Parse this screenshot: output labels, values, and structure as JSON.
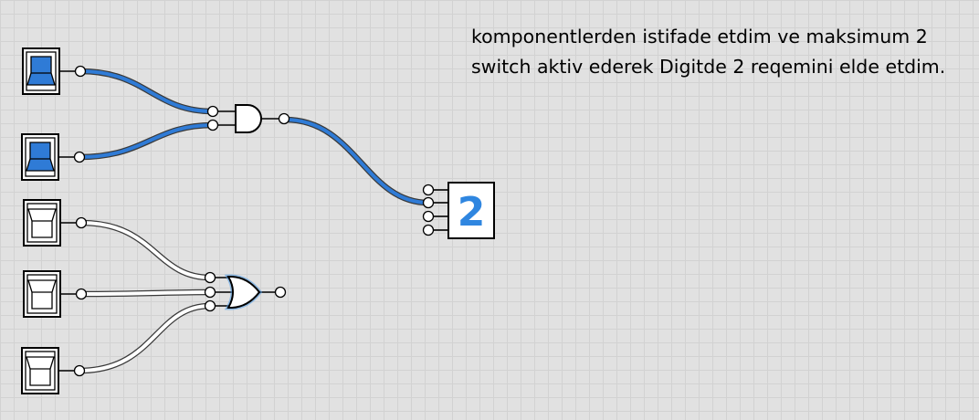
{
  "note": {
    "line1": "komponentlerden istifade etdim ve maksimum 2",
    "line2": "switch aktiv ederek Digitde 2 reqemini elde etdim."
  },
  "colors": {
    "wire_on": "#2f7bd6",
    "wire_off": "#ffffff",
    "digit": "#2f86e0",
    "switch_on": "#2f7bd6",
    "switch_off": "#ffffff",
    "gate_glow": "#4a9ae8"
  },
  "switches": [
    {
      "name": "switch-1",
      "state": "on"
    },
    {
      "name": "switch-2",
      "state": "on"
    },
    {
      "name": "switch-3",
      "state": "off"
    },
    {
      "name": "switch-4",
      "state": "off"
    },
    {
      "name": "switch-5",
      "state": "off"
    }
  ],
  "gates": {
    "and_gate": {
      "type": "AND",
      "inputs": 2,
      "output": "on"
    },
    "or_gate": {
      "type": "OR",
      "inputs": 3,
      "output": "off"
    }
  },
  "display": {
    "value": "2",
    "inputs": 4
  }
}
